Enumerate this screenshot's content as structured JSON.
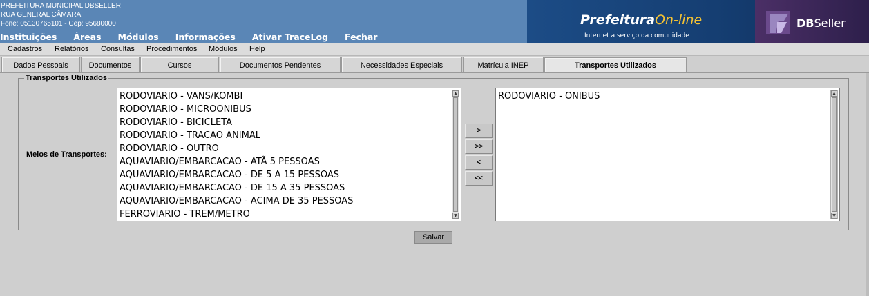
{
  "header": {
    "org_name": "PREFEITURA MUNICIPAL DBSELLER",
    "address": "RUA GENERAL CÂMARA",
    "phone": "Fone: 05130765101  -  Cep: 95680000",
    "menu": [
      "Instituições",
      "Áreas",
      "Módulos",
      "Informações",
      "Ativar TraceLog",
      "Fechar"
    ]
  },
  "banner": {
    "brand_main": "Prefeitura",
    "brand_accent": "On-line",
    "tagline": "Internet a serviço da comunidade",
    "db_bold": "DB",
    "db_light": "Seller"
  },
  "menubar": [
    "Cadastros",
    "Relatórios",
    "Consultas",
    "Procedimentos",
    "Módulos",
    "Help"
  ],
  "tabs": [
    {
      "label": "Dados Pessoais",
      "active": false
    },
    {
      "label": "Documentos",
      "active": false
    },
    {
      "label": "Cursos",
      "active": false
    },
    {
      "label": "Documentos Pendentes",
      "active": false
    },
    {
      "label": "Necessidades Especiais",
      "active": false
    },
    {
      "label": "Matrícula INEP",
      "active": false
    },
    {
      "label": "Transportes Utilizados",
      "active": true
    }
  ],
  "form": {
    "legend": "Transportes Utilizados",
    "field_label": "Meios de Transportes:",
    "available": [
      "RODOVIARIO - VANS/KOMBI",
      "RODOVIARIO - MICROONIBUS",
      "RODOVIARIO - BICICLETA",
      "RODOVIARIO - TRACAO ANIMAL",
      "RODOVIARIO - OUTRO",
      "AQUAVIARIO/EMBARCACAO - ATÃ 5 PESSOAS",
      "AQUAVIARIO/EMBARCACAO - DE 5 A 15 PESSOAS",
      "AQUAVIARIO/EMBARCACAO - DE 15 A 35 PESSOAS",
      "AQUAVIARIO/EMBARCACAO - ACIMA DE 35 PESSOAS",
      "FERROVIARIO - TREM/METRO"
    ],
    "selected": [
      "RODOVIARIO - ONIBUS"
    ],
    "buttons": {
      "move_one": ">",
      "move_all": ">>",
      "remove_one": "<",
      "remove_all": "<<"
    },
    "save_label": "Salvar"
  },
  "colors": {
    "header_bg": "#5a86b6",
    "banner_bg": "#1c4c86",
    "accent": "#f4c233",
    "page_bg": "#cfcfcf"
  }
}
